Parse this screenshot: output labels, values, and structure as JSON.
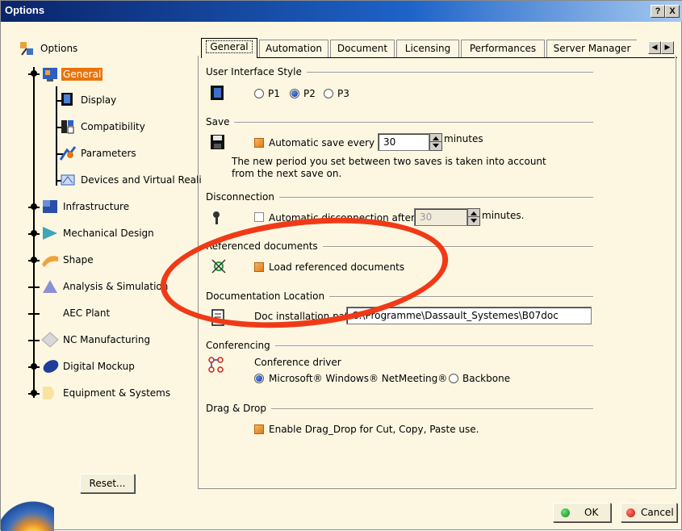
{
  "window": {
    "title": "Options",
    "help_label": "?",
    "close_label": "X"
  },
  "tree": {
    "root": "Options",
    "items": [
      {
        "label": "General"
      },
      {
        "label": "Display"
      },
      {
        "label": "Compatibility"
      },
      {
        "label": "Parameters"
      },
      {
        "label": "Devices and Virtual Reali"
      },
      {
        "label": "Infrastructure"
      },
      {
        "label": "Mechanical Design"
      },
      {
        "label": "Shape"
      },
      {
        "label": "Analysis & Simulation"
      },
      {
        "label": "AEC Plant"
      },
      {
        "label": "NC Manufacturing"
      },
      {
        "label": "Digital Mockup"
      },
      {
        "label": "Equipment & Systems"
      }
    ],
    "reset_label": "Reset..."
  },
  "tabs": [
    "General",
    "Automation",
    "Document",
    "Licensing",
    "Performances",
    "Server Manager"
  ],
  "tab_scroll": {
    "left": "◀",
    "right": "▶"
  },
  "ui_style": {
    "title": "User Interface Style",
    "options": [
      "P1",
      "P2",
      "P3"
    ],
    "selected": "P2"
  },
  "save": {
    "title": "Save",
    "checkbox_label": "Automatic save every",
    "checked": true,
    "value": "30",
    "unit": "minutes",
    "note_line1": "The new period you set between two saves is taken into account",
    "note_line2": "from the next save on."
  },
  "disconnection": {
    "title": "Disconnection",
    "checkbox_label": "Automatic disconnection after",
    "checked": false,
    "value": "30",
    "unit": "minutes."
  },
  "referenced": {
    "title": "Referenced documents",
    "checkbox_label": "Load referenced documents",
    "checked": true
  },
  "doc_location": {
    "title": "Documentation Location",
    "label": "Doc installation path",
    "value": "C:\\Programme\\Dassault_Systemes\\B07doc"
  },
  "conferencing": {
    "title": "Conferencing",
    "driver_label": "Conference driver",
    "options": [
      "Microsoft® Windows® NetMeeting®",
      "Backbone"
    ],
    "selected": "Microsoft® Windows® NetMeeting®"
  },
  "dragdrop": {
    "title": "Drag & Drop",
    "checkbox_label": "Enable Drag_Drop for Cut, Copy, Paste use.",
    "checked": true
  },
  "buttons": {
    "ok": "OK",
    "cancel": "Cancel"
  },
  "colors": {
    "annotation": "#f03a17",
    "selection": "#e8740a",
    "background": "#fdf7e2"
  }
}
